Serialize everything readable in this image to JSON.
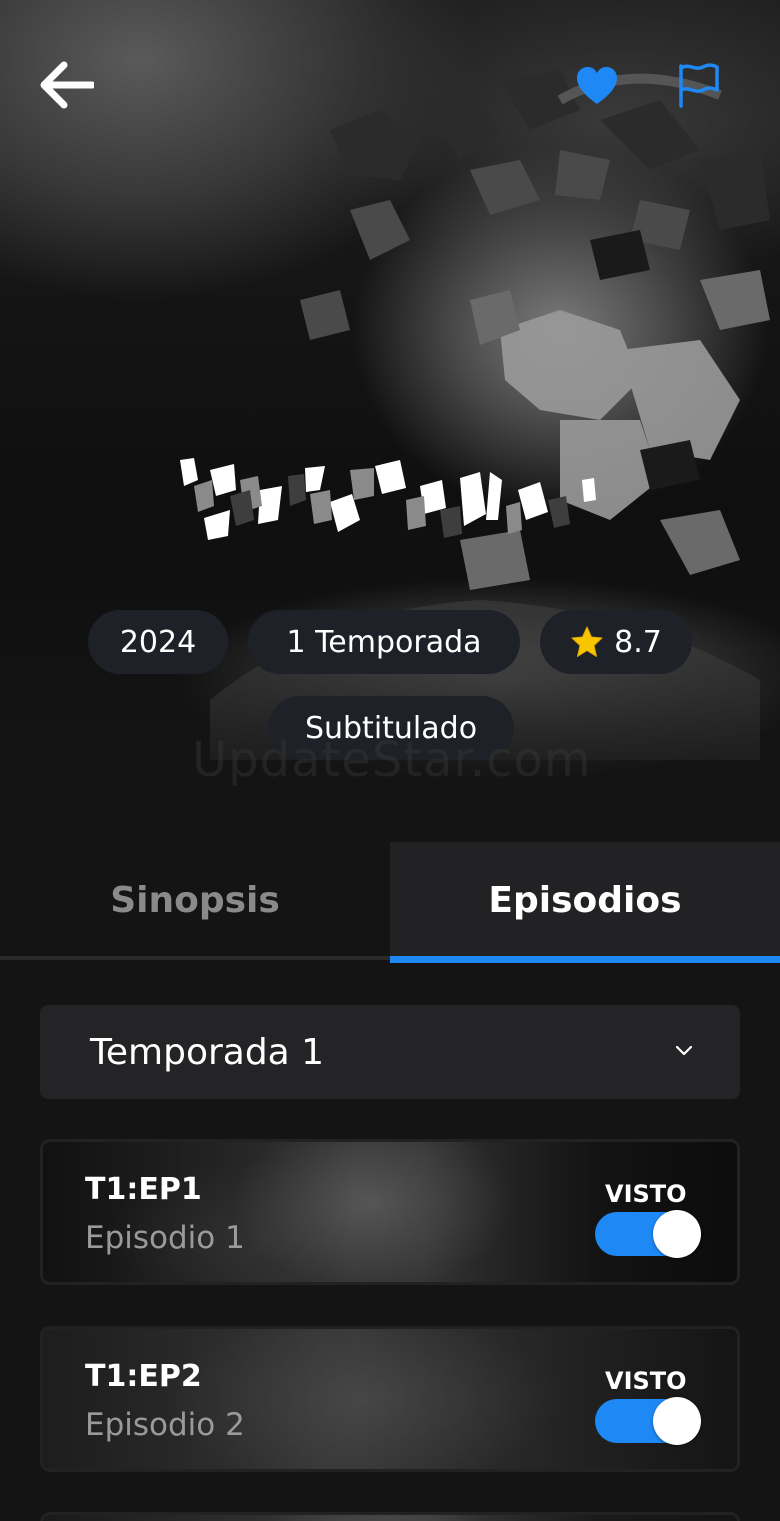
{
  "header": {
    "back_icon": "arrow-left-icon",
    "favorite_icon": "heart-icon",
    "report_icon": "flag-icon",
    "accent_color": "#1e88f5"
  },
  "meta": {
    "year": "2024",
    "seasons": "1 Temporada",
    "rating": "8.7",
    "rating_icon": "star-icon",
    "language": "Subtitulado"
  },
  "watermark": "UpdateStar.com",
  "tabs": [
    {
      "label": "Sinopsis",
      "active": false
    },
    {
      "label": "Episodios",
      "active": true
    }
  ],
  "season_select": {
    "value": "Temporada 1",
    "icon": "chevron-down-icon"
  },
  "episodes": [
    {
      "code": "T1:EP1",
      "title": "Episodio 1",
      "watched_label": "VISTO",
      "watched": true
    },
    {
      "code": "T1:EP2",
      "title": "Episodio 2",
      "watched_label": "VISTO",
      "watched": true
    }
  ]
}
